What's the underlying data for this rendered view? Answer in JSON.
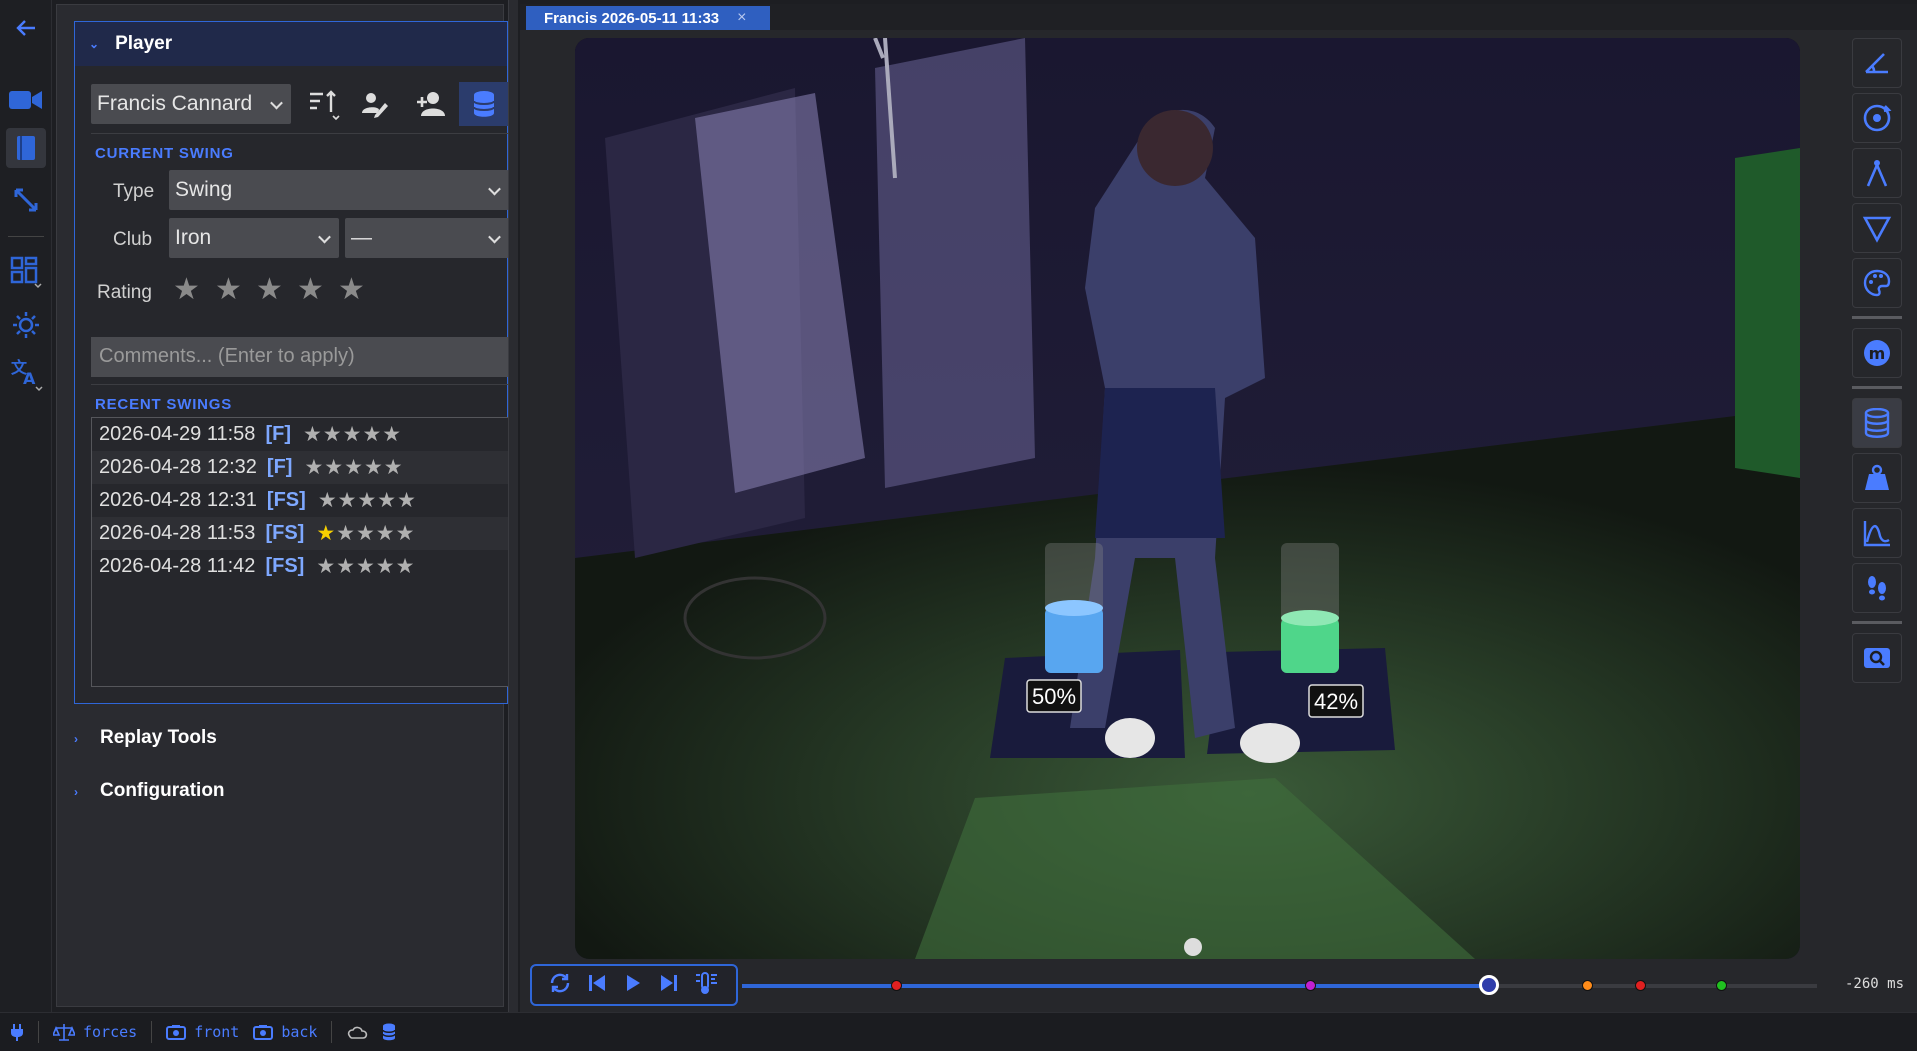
{
  "player_panel": {
    "title": "Player",
    "player_name": "Francis Cannard",
    "current_swing": {
      "heading": "CURRENT SWING",
      "type_label": "Type",
      "type_value": "Swing",
      "club_label": "Club",
      "club_value": "Iron",
      "club_sub_value": "—",
      "rating_label": "Rating",
      "comments_placeholder": "Comments... (Enter to apply)"
    },
    "recent_swings": {
      "heading": "RECENT SWINGS",
      "items": [
        {
          "date": "2026-04-29 11:58",
          "tag": "[F]",
          "stars": "★★★★★",
          "rating": 0
        },
        {
          "date": "2026-04-28 12:32",
          "tag": "[F]",
          "stars": "★★★★★",
          "rating": 0
        },
        {
          "date": "2026-04-28 12:31",
          "tag": "[FS]",
          "stars": "★★★★★",
          "rating": 0
        },
        {
          "date": "2026-04-28 11:53",
          "tag": "[FS]",
          "stars_on": "★",
          "stars": "★★★★",
          "rating": 1
        },
        {
          "date": "2026-04-28 11:42",
          "tag": "[FS]",
          "stars": "★★★★★",
          "rating": 0
        }
      ]
    }
  },
  "sections": {
    "replay_tools": "Replay Tools",
    "configuration": "Configuration"
  },
  "tab": {
    "title": "Francis 2026-05-11 11:33",
    "close": "×"
  },
  "video": {
    "left_pressure_label": "50%",
    "right_pressure_label": "42%",
    "left_pressure": 0.5,
    "right_pressure": 0.42,
    "left_color": "#58a6f0",
    "right_color": "#4fd68a"
  },
  "playback": {
    "time_offset": "-260 ms",
    "progress": 0.695,
    "markers": [
      {
        "pos": 0.143,
        "color": "#e02020"
      },
      {
        "pos": 0.528,
        "color": "#c020d0"
      },
      {
        "pos": 0.786,
        "color": "#ff8c1a"
      },
      {
        "pos": 0.835,
        "color": "#e02020"
      },
      {
        "pos": 0.911,
        "color": "#20c020"
      }
    ]
  },
  "status_bar": {
    "forces": "forces",
    "front": "front",
    "back": "back"
  },
  "colors": {
    "accent": "#2f66d8",
    "accent_text": "#4a7cff",
    "star_on": "#f7d000"
  }
}
